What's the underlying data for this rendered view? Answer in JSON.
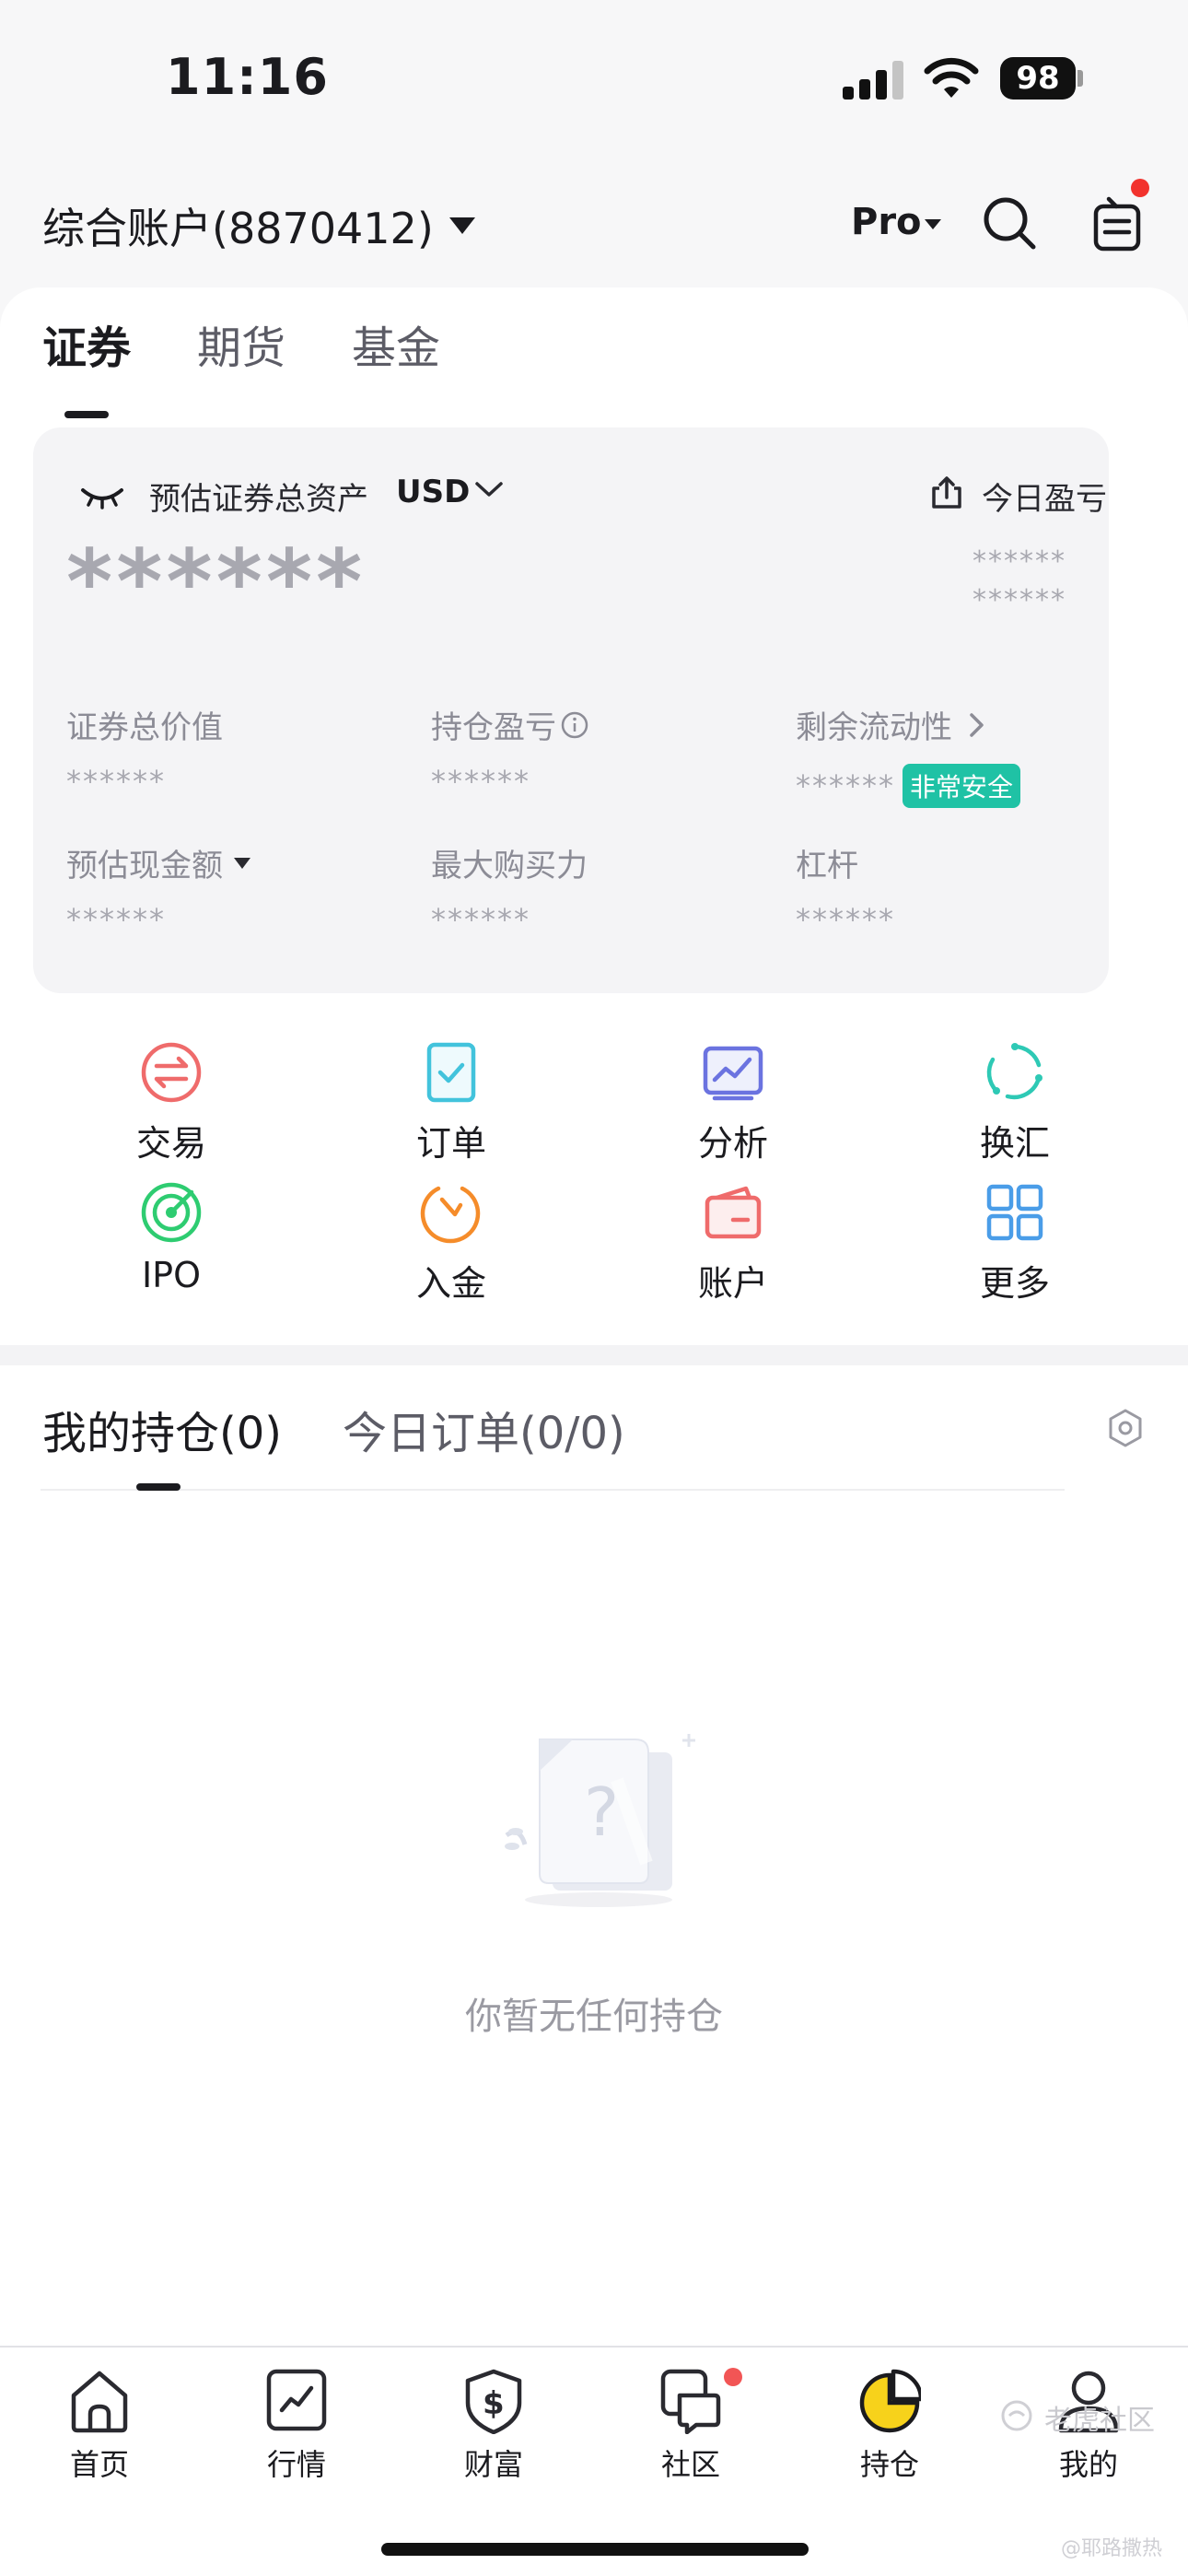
{
  "status_bar": {
    "time": "11:16",
    "battery": "98"
  },
  "header": {
    "account_title": "综合账户(8870412)",
    "pro_label": "Pro"
  },
  "asset_tabs": [
    {
      "label": "证券"
    },
    {
      "label": "期货"
    },
    {
      "label": "基金"
    }
  ],
  "asset_card": {
    "total_label": "预估证券总资产",
    "currency": "USD",
    "today_pl_label": "今日盈亏",
    "total_value": "******",
    "today_pl_value_1": "******",
    "today_pl_value_2": "******",
    "metrics": [
      {
        "label": "证券总价值",
        "value": "******"
      },
      {
        "label": "持仓盈亏",
        "value": "******"
      },
      {
        "label": "剩余流动性",
        "value": "******",
        "badge": "非常安全"
      },
      {
        "label": "预估现金额",
        "value": "******"
      },
      {
        "label": "最大购买力",
        "value": "******"
      },
      {
        "label": "杠杆",
        "value": "******"
      }
    ]
  },
  "quick_actions": [
    {
      "label": "交易",
      "icon": "exchange-arrows-icon",
      "color": "#ef6b6b"
    },
    {
      "label": "订单",
      "icon": "order-check-icon",
      "color": "#42c3dc"
    },
    {
      "label": "分析",
      "icon": "analysis-chart-icon",
      "color": "#6b73e0"
    },
    {
      "label": "换汇",
      "icon": "currency-exchange-icon",
      "color": "#2ec9b5"
    },
    {
      "label": "IPO",
      "icon": "ipo-target-icon",
      "color": "#2ecc71"
    },
    {
      "label": "入金",
      "icon": "deposit-icon",
      "color": "#f58c2a"
    },
    {
      "label": "账户",
      "icon": "wallet-icon",
      "color": "#ef6b6b"
    },
    {
      "label": "更多",
      "icon": "grid-more-icon",
      "color": "#4a9de8"
    }
  ],
  "holdings": {
    "tabs": [
      {
        "label": "我的持仓(0)"
      },
      {
        "label": "今日订单(0/0)"
      }
    ],
    "empty_text": "你暂无任何持仓"
  },
  "tab_bar": [
    {
      "label": "首页",
      "icon": "home-icon"
    },
    {
      "label": "行情",
      "icon": "market-chart-icon"
    },
    {
      "label": "财富",
      "icon": "wealth-dollar-icon"
    },
    {
      "label": "社区",
      "icon": "community-chat-icon"
    },
    {
      "label": "持仓",
      "icon": "portfolio-pie-icon"
    },
    {
      "label": "我的",
      "icon": "profile-icon"
    }
  ],
  "watermark": {
    "text": "老虎社区",
    "sub": "@耶路撒热"
  },
  "colors": {
    "accent_yellow": "#f7d21b",
    "safe_green": "#1fc2a5",
    "alert_red": "#f2322d"
  }
}
